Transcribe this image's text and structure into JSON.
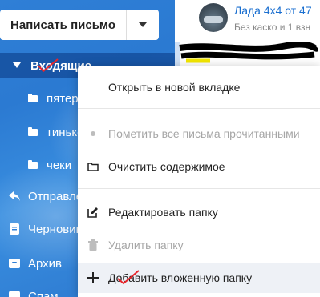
{
  "sidebar": {
    "compose_label": "Написать письмо",
    "folders": [
      {
        "label": "Входящие",
        "icon": "chevron-down-icon"
      },
      {
        "label": "пятерочка",
        "icon": "folder-icon"
      },
      {
        "label": "тинькофф",
        "icon": "folder-icon"
      },
      {
        "label": "чеки",
        "icon": "folder-icon"
      },
      {
        "label": "Отправленные",
        "icon": "reply-icon"
      },
      {
        "label": "Черновики",
        "icon": "draft-icon"
      },
      {
        "label": "Архив",
        "icon": "archive-icon"
      },
      {
        "label": "Спам",
        "icon": "spam-icon"
      }
    ]
  },
  "mail": {
    "subject": "Лада 4x4 от 47",
    "snippet": "Без каско и 1 взн"
  },
  "context_menu": {
    "items": [
      {
        "label": "Открыть в новой вкладке",
        "icon": "",
        "disabled": false
      },
      {
        "label": "Пометить все письма прочитанными",
        "icon": "dot-icon",
        "disabled": true
      },
      {
        "label": "Очистить содержимое",
        "icon": "folder-outline-icon",
        "disabled": false
      },
      {
        "label": "Редактировать папку",
        "icon": "edit-icon",
        "disabled": false
      },
      {
        "label": "Удалить папку",
        "icon": "trash-icon",
        "disabled": true
      },
      {
        "label": "Добавить вложенную папку",
        "icon": "plus-icon",
        "disabled": false
      }
    ]
  }
}
